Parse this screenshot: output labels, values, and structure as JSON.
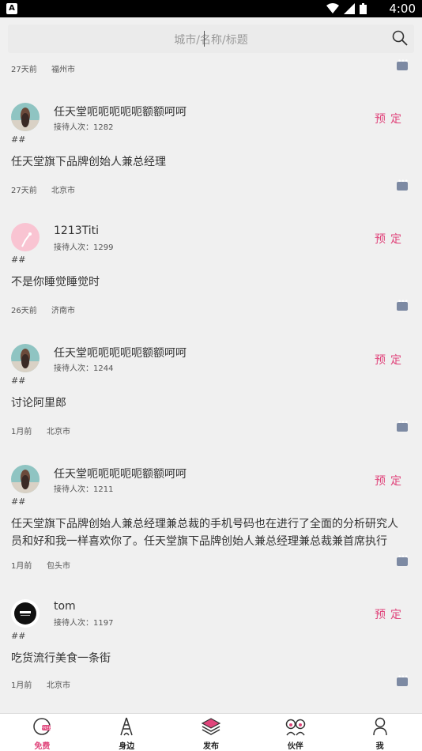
{
  "status_bar": {
    "time": "4:00",
    "app_badge": "A"
  },
  "search": {
    "placeholder": "城市/名称/标题"
  },
  "first_meta": {
    "ago": "27天前",
    "city": "福州市"
  },
  "posts": [
    {
      "name": "任天堂呃呃呃呃呃额额呵呵",
      "visits_label": "接待人次：1282",
      "tags": "##",
      "body": "任天堂旗下品牌创始人兼总经理",
      "ago": "27天前",
      "city": "北京市",
      "book": "预定"
    },
    {
      "name": "1213Titi",
      "visits_label": "接待人次：1299",
      "tags": "##",
      "body": "不是你睡觉睡觉时",
      "ago": "26天前",
      "city": "济南市",
      "book": "预定"
    },
    {
      "name": "任天堂呃呃呃呃呃额额呵呵",
      "visits_label": "接待人次：1244",
      "tags": "##",
      "body": "讨论阿里郎",
      "ago": "1月前",
      "city": "北京市",
      "book": "预定"
    },
    {
      "name": "任天堂呃呃呃呃呃额额呵呵",
      "visits_label": "接待人次：1211",
      "tags": "##",
      "body": "任天堂旗下品牌创始人兼总经理兼总裁的手机号码也在进行了全面的分析研究人员和好和我一样喜欢你了。任天堂旗下品牌创始人兼总经理兼总裁兼首席执行",
      "ago": "1月前",
      "city": "包头市",
      "book": "预定"
    },
    {
      "name": "tom",
      "visits_label": "接待人次：1197",
      "tags": "##",
      "body": "吃货流行美食一条街",
      "ago": "1月前",
      "city": "北京市",
      "book": "预定"
    }
  ],
  "tabs": [
    {
      "label": "免费",
      "icon": "free-icon"
    },
    {
      "label": "身边",
      "icon": "tower-icon"
    },
    {
      "label": "发布",
      "icon": "layers-icon"
    },
    {
      "label": "伙伴",
      "icon": "partners-icon"
    },
    {
      "label": "我",
      "icon": "person-icon"
    }
  ],
  "colors": {
    "accent": "#e0457b",
    "msg_icon": "#7d8aa3"
  }
}
